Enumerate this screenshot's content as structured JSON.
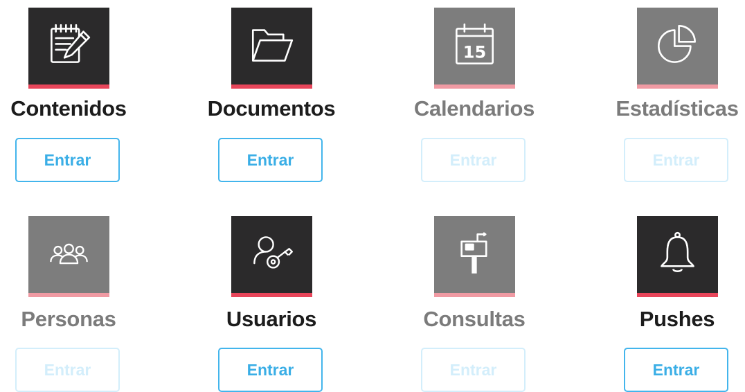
{
  "colors": {
    "active_tile": "#2b2a2b",
    "inactive_tile": "#7d7d7d",
    "active_accent": "#e8455a",
    "inactive_accent": "#f09aa3",
    "button_active": "#43b5ec",
    "button_inactive": "#d3eefb"
  },
  "modules": [
    {
      "label": "Contenidos",
      "icon": "notepad-pencil-icon",
      "button": "Entrar",
      "enabled": true
    },
    {
      "label": "Documentos",
      "icon": "open-folder-icon",
      "button": "Entrar",
      "enabled": true
    },
    {
      "label": "Calendarios",
      "icon": "calendar-icon",
      "calendar_day": "15",
      "button": "Entrar",
      "enabled": false
    },
    {
      "label": "Estadísticas",
      "icon": "pie-chart-icon",
      "button": "Entrar",
      "enabled": false
    },
    {
      "label": "Personas",
      "icon": "people-group-icon",
      "button": "Entrar",
      "enabled": false
    },
    {
      "label": "Usuarios",
      "icon": "user-key-icon",
      "button": "Entrar",
      "enabled": true
    },
    {
      "label": "Consultas",
      "icon": "mailbox-icon",
      "button": "Entrar",
      "enabled": false
    },
    {
      "label": "Pushes",
      "icon": "bell-icon",
      "button": "Entrar",
      "enabled": true
    }
  ]
}
